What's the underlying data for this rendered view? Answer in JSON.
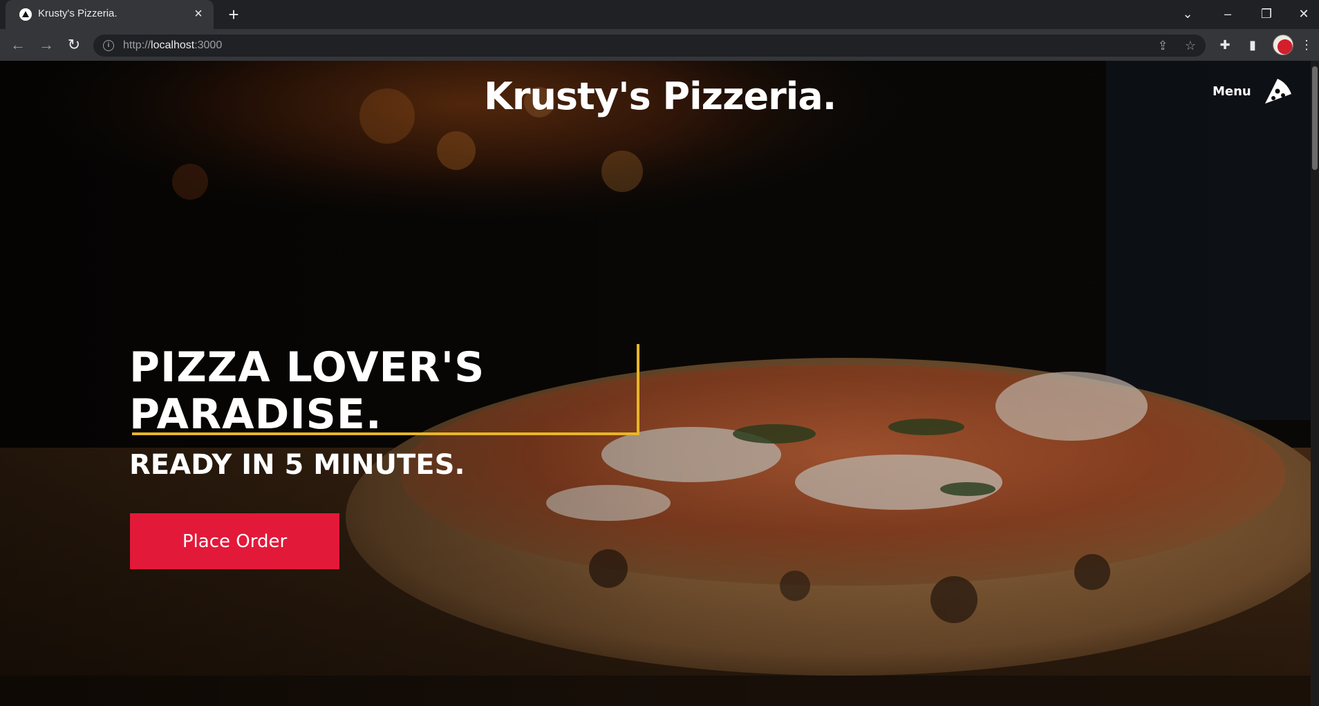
{
  "browser": {
    "tab_title": "Krusty's Pizzeria.",
    "url_prefix": "http://",
    "url_host": "localhost",
    "url_port": ":3000",
    "new_tab_glyph": "+",
    "close_glyph": "×"
  },
  "site": {
    "brand": "Krusty's Pizzeria.",
    "menu_label": "Menu"
  },
  "hero": {
    "headline_line1": "PIZZA LOVER'S",
    "headline_line2": "PARADISE.",
    "subhead": "READY IN 5 MINUTES.",
    "cta_label": "Place Order"
  },
  "colors": {
    "accent": "#e8b626",
    "cta": "#e3193a",
    "chrome_bg": "#202124",
    "chrome_toolbar": "#35363a"
  },
  "icons": {
    "menu_icon": "pizza-slice-icon",
    "tab_favicon": "triangle-logo-icon"
  }
}
